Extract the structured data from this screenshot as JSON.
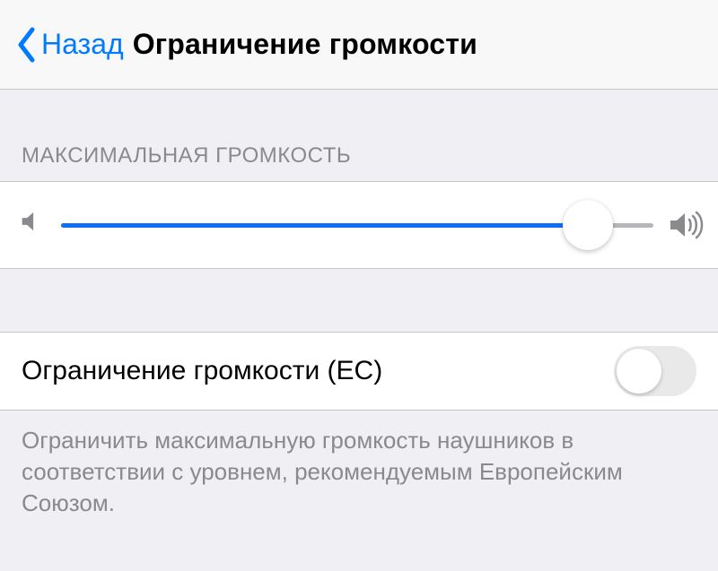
{
  "nav": {
    "back_label": "Назад",
    "title": "Ограничение громкости"
  },
  "section": {
    "max_volume_header": "МАКСИМАЛЬНАЯ ГРОМКОСТЬ"
  },
  "slider": {
    "value_percent": 89
  },
  "toggle": {
    "label": "Ограничение громкости (ЕС)",
    "on": false
  },
  "footer": {
    "note": "Ограничить максимальную громкость наушников в соответствии с уровнем, рекомендуемым Европейским Союзом."
  },
  "icons": {
    "back": "chevron-left-icon",
    "speaker_min": "speaker-min-icon",
    "speaker_max": "speaker-max-icon"
  },
  "colors": {
    "tint": "#007aff",
    "slider_fill": "#0f70f6",
    "background": "#efeff4",
    "separator": "#c6c6c8",
    "secondary_text": "#8a8a8e"
  }
}
